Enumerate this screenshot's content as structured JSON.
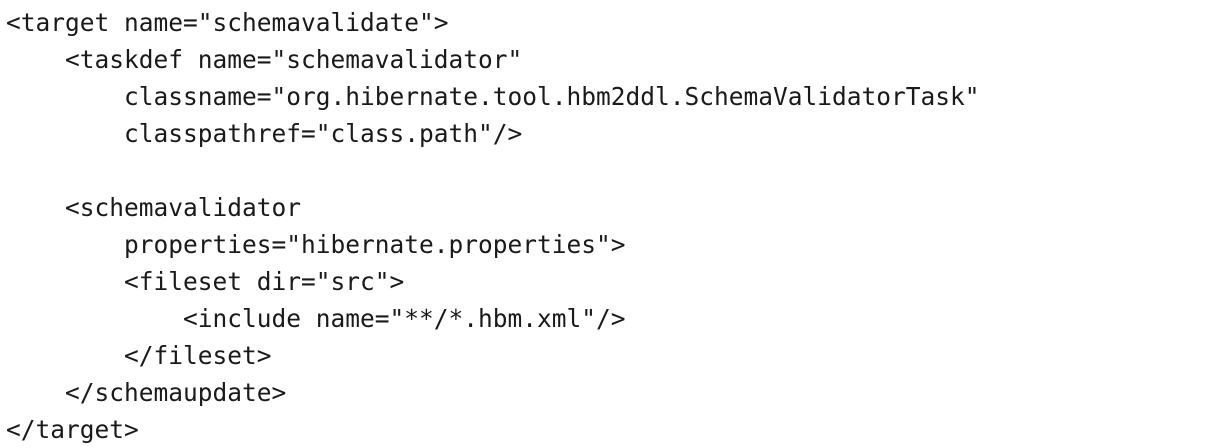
{
  "code": {
    "lines": [
      "<target name=\"schemavalidate\">",
      "    <taskdef name=\"schemavalidator\"",
      "        classname=\"org.hibernate.tool.hbm2ddl.SchemaValidatorTask\"",
      "        classpathref=\"class.path\"/>",
      "",
      "    <schemavalidator",
      "        properties=\"hibernate.properties\">",
      "        <fileset dir=\"src\">",
      "            <include name=\"**/*.hbm.xml\"/>",
      "        </fileset>",
      "    </schemaupdate>",
      "</target>"
    ]
  }
}
